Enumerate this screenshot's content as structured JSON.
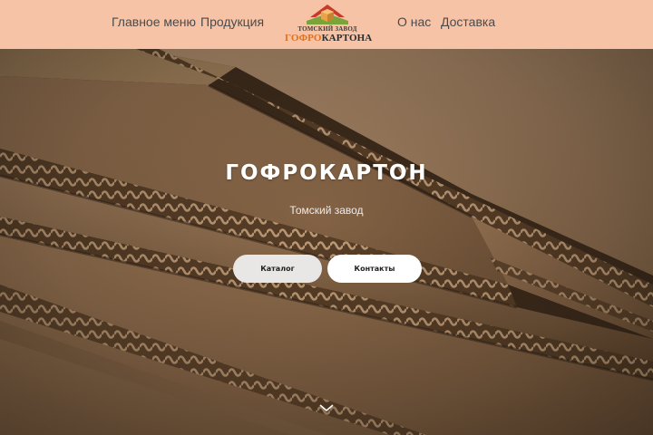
{
  "nav": {
    "main_menu": "Главное меню",
    "products": "Продукция",
    "about": "О нас",
    "delivery": "Доставка"
  },
  "logo": {
    "top_text": "ТОМСКИЙ ЗАВОД",
    "main_part1": "ГОФРО",
    "main_part2": "КАРТОНА",
    "icon": "box-house-icon"
  },
  "hero": {
    "title": "ГОФРОКАРТОН",
    "subtitle": "Томский завод",
    "buttons": {
      "catalog": "Каталог",
      "contacts": "Контакты"
    },
    "scroll_icon": "chevron-down-icon"
  },
  "colors": {
    "header_bg": "#f6c3a6",
    "accent": "#e0701e",
    "nav_text": "#4b4b4b",
    "cardboard": "#a9805a"
  }
}
